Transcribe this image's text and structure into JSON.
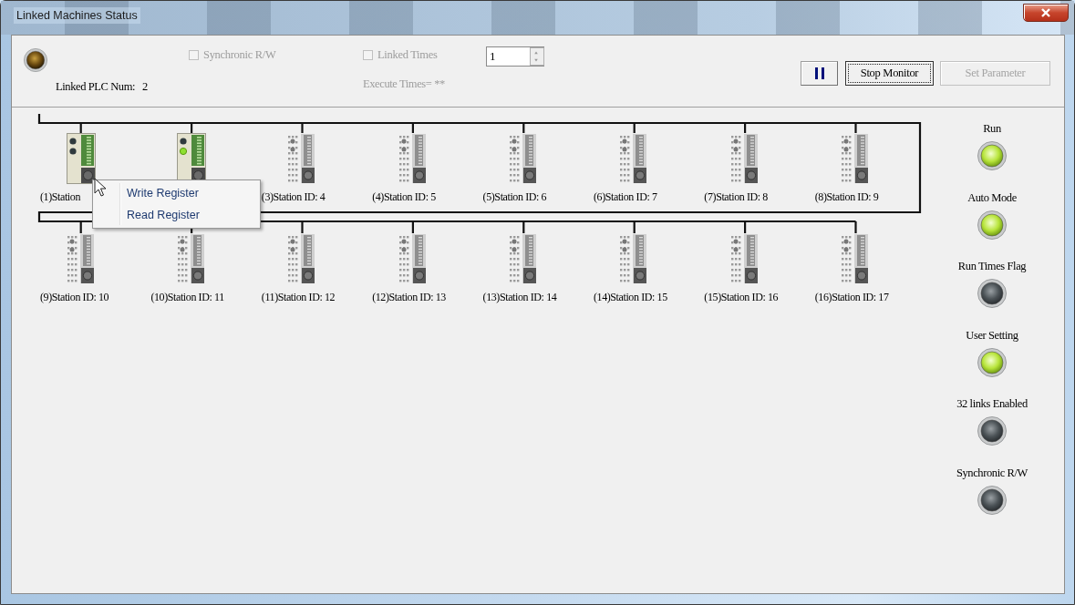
{
  "window": {
    "title": "Linked Machines Status"
  },
  "toolbar": {
    "status_lamp": {
      "on": false
    },
    "linked_plc_num": {
      "label": "Linked PLC Num:",
      "value": "2"
    },
    "synchronic_rw": {
      "label": "Synchronic R/W",
      "checked": false,
      "disabled": true
    },
    "linked_times": {
      "label": "Linked Times",
      "checked": false,
      "disabled": true,
      "value": "1"
    },
    "execute_times": {
      "text": "Execute Times= **",
      "disabled": true
    },
    "buttons": [
      {
        "kind": "pause",
        "focused": false,
        "disabled": false
      },
      {
        "kind": "text",
        "label": "Stop Monitor",
        "focused": true,
        "disabled": false
      },
      {
        "kind": "text",
        "label": "Set Parameter",
        "focused": false,
        "disabled": true
      }
    ]
  },
  "stations": [
    {
      "label": "(1)Station",
      "online": true,
      "run": false
    },
    {
      "online": true,
      "run": true
    },
    {
      "label": "(3)Station ID: 4",
      "online": false
    },
    {
      "label": "(4)Station ID: 5",
      "online": false
    },
    {
      "label": "(5)Station ID: 6",
      "online": false
    },
    {
      "label": "(6)Station ID: 7",
      "online": false
    },
    {
      "label": "(7)Station ID: 8",
      "online": false
    },
    {
      "label": "(8)Station ID: 9",
      "online": false
    },
    {
      "label": "(9)Station ID: 10",
      "online": false
    },
    {
      "label": "(10)Station ID: 11",
      "online": false
    },
    {
      "label": "(11)Station ID: 12",
      "online": false
    },
    {
      "label": "(12)Station ID: 13",
      "online": false
    },
    {
      "label": "(13)Station ID: 14",
      "online": false
    },
    {
      "label": "(14)Station ID: 15",
      "online": false
    },
    {
      "label": "(15)Station ID: 16",
      "online": false
    },
    {
      "label": "(16)Station ID: 17",
      "online": false
    }
  ],
  "context_menu": {
    "items": [
      {
        "label": "Write Register"
      },
      {
        "label": "Read Register"
      }
    ]
  },
  "indicators": [
    {
      "label": "Run",
      "on": true
    },
    {
      "label": "Auto Mode",
      "on": true
    },
    {
      "label": "Run Times Flag",
      "on": false
    },
    {
      "label": "User Setting",
      "on": true
    },
    {
      "label": "32 links Enabled",
      "on": false
    },
    {
      "label": "Synchronic R/W",
      "on": false
    }
  ]
}
